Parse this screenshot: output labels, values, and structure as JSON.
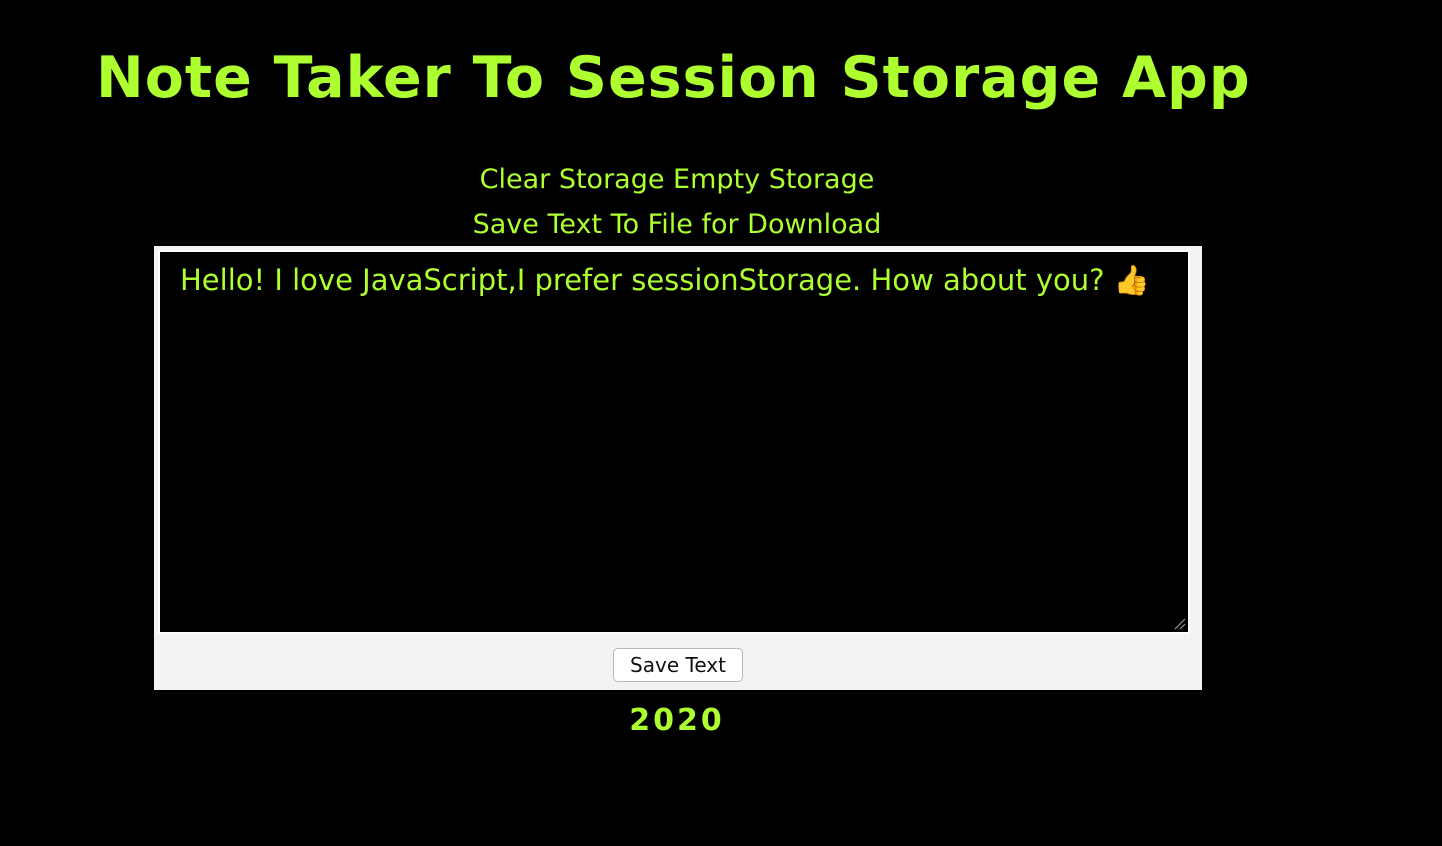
{
  "app": {
    "title": "Note Taker To Session Storage App"
  },
  "actions": {
    "clear_storage_label": "Clear Storage Empty Storage",
    "save_to_file_label": "Save Text To File for Download"
  },
  "editor": {
    "value": "Hello! I love JavaScript,I prefer sessionStorage. How about you? 👍",
    "save_button_label": "Save Text"
  },
  "footer": {
    "year": "2020"
  },
  "colors": {
    "accent": "#adff2f",
    "background": "#000000",
    "panel": "#f3f3f3"
  }
}
